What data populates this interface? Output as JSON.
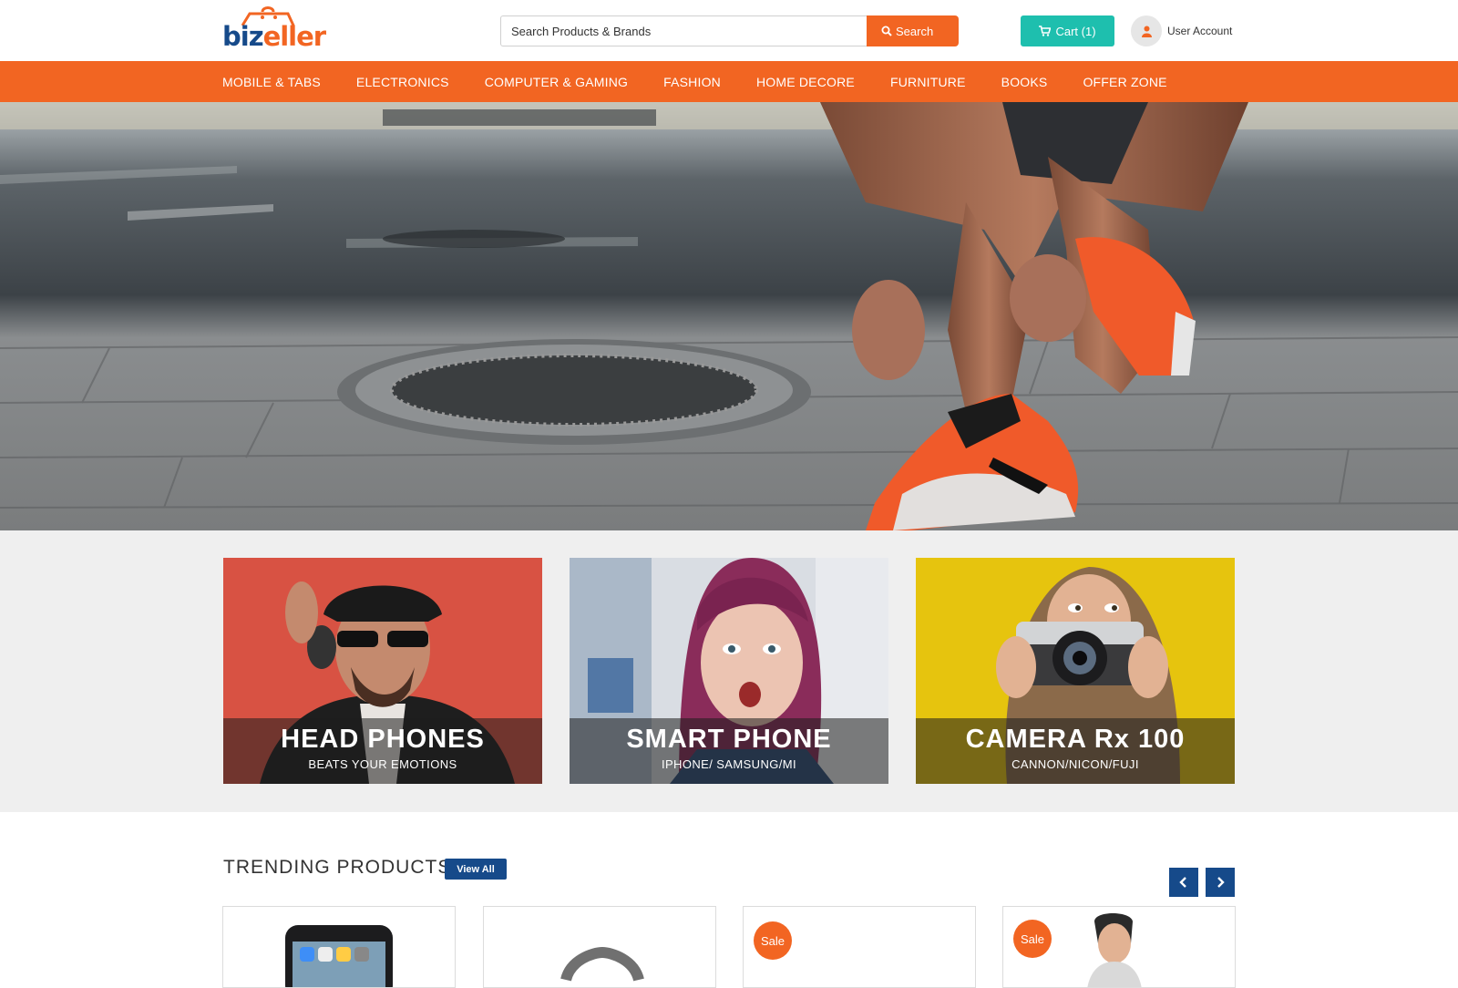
{
  "brand": {
    "logo_text_biz": "biz",
    "logo_text_eller": "eller",
    "primary_color": "#f26522",
    "secondary_color": "#164a8a",
    "accent_color": "#1ebfae"
  },
  "header": {
    "search_placeholder": "Search Products & Brands",
    "search_button": "Search",
    "search_icon": "search-icon",
    "cart_label": "Cart (1)",
    "cart_icon": "shopping-cart-icon",
    "account_label": "User Account",
    "account_icon": "user-icon"
  },
  "nav": {
    "items": [
      {
        "label": "MOBILE & TABS"
      },
      {
        "label": "ELECTRONICS"
      },
      {
        "label": "COMPUTER & GAMING"
      },
      {
        "label": "FASHION"
      },
      {
        "label": "HOME DECORE"
      },
      {
        "label": "FURNITURE"
      },
      {
        "label": "BOOKS"
      },
      {
        "label": "OFFER ZONE"
      }
    ]
  },
  "promos": [
    {
      "title": "HEAD PHONES",
      "subtitle": "BEATS YOUR EMOTIONS"
    },
    {
      "title": "SMART PHONE",
      "subtitle": "IPHONE/ SAMSUNG/MI"
    },
    {
      "title": "CAMERA Rx 100",
      "subtitle": "CANNON/NICON/FUJI"
    }
  ],
  "trending": {
    "title": "TRENDING PRODUCTS",
    "view_all": "View All",
    "prev_icon": "chevron-left-icon",
    "next_icon": "chevron-right-icon",
    "products": [
      {
        "sale_label": ""
      },
      {
        "sale_label": ""
      },
      {
        "sale_label": "Sale"
      },
      {
        "sale_label": "Sale"
      }
    ]
  }
}
